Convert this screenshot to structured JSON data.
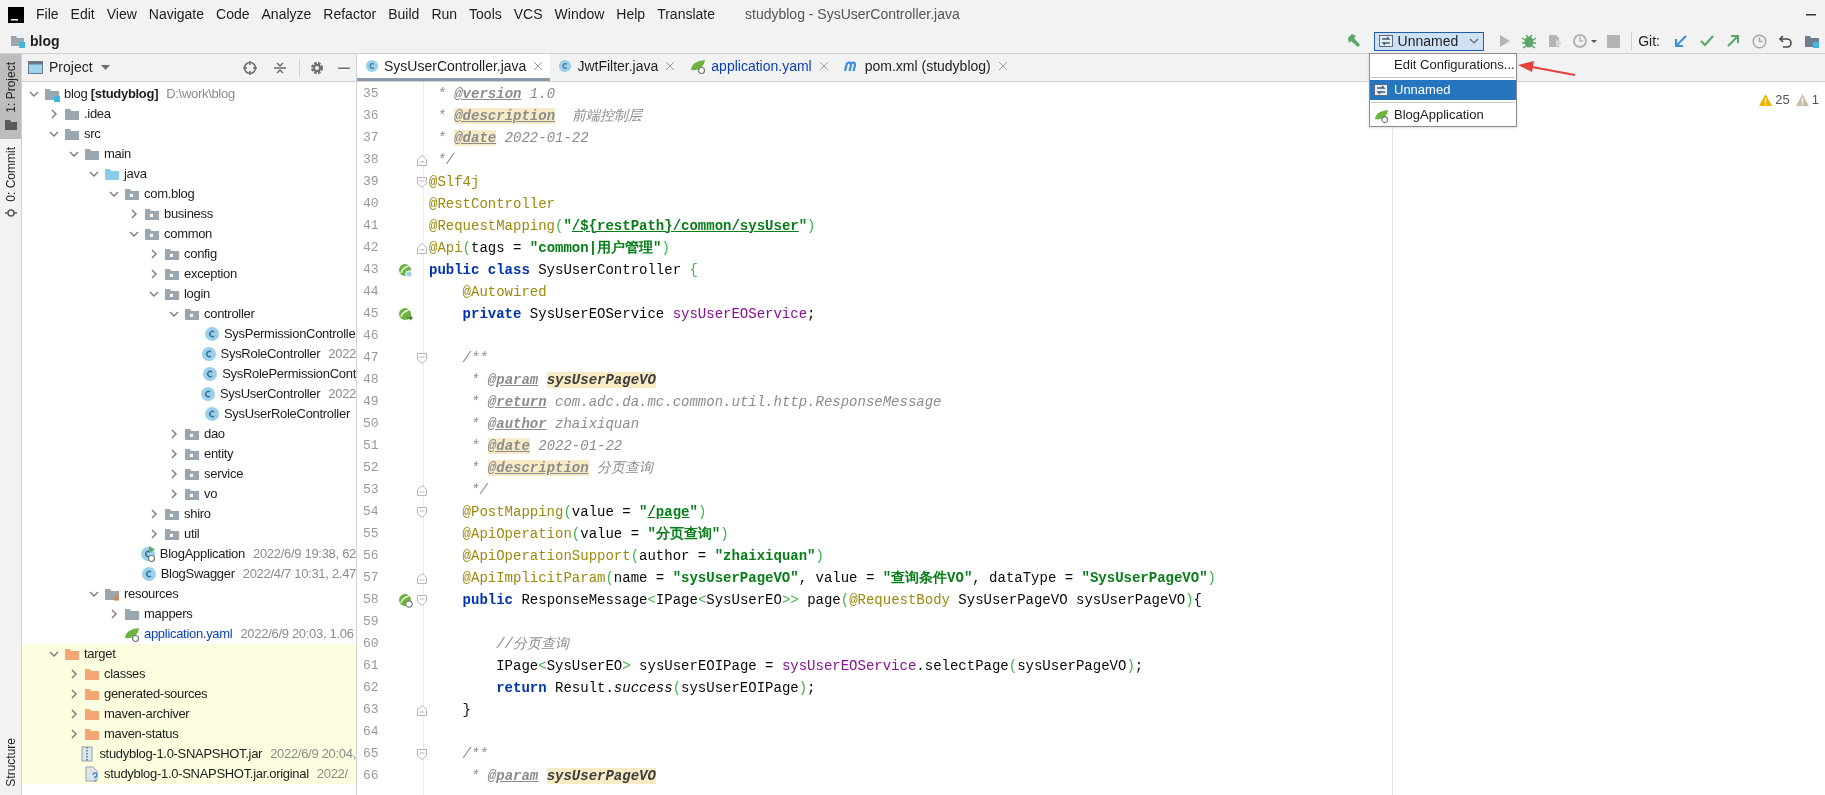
{
  "window": {
    "title": "studyblog - SysUserController.java"
  },
  "menu": [
    "File",
    "Edit",
    "View",
    "Navigate",
    "Code",
    "Analyze",
    "Refactor",
    "Build",
    "Run",
    "Tools",
    "VCS",
    "Window",
    "Help",
    "Translate"
  ],
  "breadcrumb": "blog",
  "toolbar": [
    {
      "kind": "build",
      "disabled": false
    },
    {
      "kind": "run",
      "disabled": true
    },
    {
      "kind": "debug",
      "disabled": false
    },
    {
      "kind": "coverage",
      "disabled": true
    },
    {
      "kind": "profile",
      "disabled": true
    },
    {
      "kind": "stop",
      "disabled": true
    }
  ],
  "run_config": {
    "label": "Unnamed",
    "expanded": true
  },
  "git": {
    "label": "Git:",
    "actions": [
      {
        "kind": "update"
      },
      {
        "kind": "commit"
      },
      {
        "kind": "push"
      },
      {
        "kind": "history"
      },
      {
        "kind": "rollback"
      },
      {
        "kind": "project"
      }
    ]
  },
  "run_config_menu": [
    {
      "label": "Edit Configurations...",
      "kind": "action",
      "selected": false
    },
    {
      "label": "Unnamed",
      "kind": "config",
      "selected": true
    },
    {
      "label": "BlogApplication",
      "kind": "app",
      "selected": false
    }
  ],
  "left_stripe": [
    {
      "label": "1: Project",
      "kind": "project",
      "selected": true
    },
    {
      "label": "0: Commit",
      "kind": "commit",
      "selected": false
    },
    {
      "label": "Structure",
      "kind": "structure",
      "selected": false
    }
  ],
  "project_panel": {
    "title": "Project"
  },
  "project_tree": [
    {
      "name": "blog **[studyblog]**",
      "detail": "D:\\work\\blog",
      "kind": "module",
      "expanded": true,
      "children": [
        {
          "name": ".idea",
          "kind": "folder",
          "expanded": false
        },
        {
          "name": "src",
          "kind": "folder",
          "expanded": true,
          "children": [
            {
              "name": "main",
              "kind": "folder",
              "expanded": true,
              "children": [
                {
                  "name": "java",
                  "kind": "source-root",
                  "expanded": true,
                  "children": [
                    {
                      "name": "com.blog",
                      "kind": "package",
                      "expanded": true,
                      "children": [
                        {
                          "name": "business",
                          "kind": "package",
                          "expanded": false
                        },
                        {
                          "name": "common",
                          "kind": "package",
                          "expanded": true,
                          "children": [
                            {
                              "name": "config",
                              "kind": "package",
                              "expanded": false
                            },
                            {
                              "name": "exception",
                              "kind": "package",
                              "expanded": false
                            },
                            {
                              "name": "login",
                              "kind": "package",
                              "expanded": true,
                              "children": [
                                {
                                  "name": "controller",
                                  "kind": "package",
                                  "expanded": true,
                                  "children": [
                                    {
                                      "name": "SysPermissionControlle",
                                      "kind": "class",
                                      "modified": false
                                    },
                                    {
                                      "name": "SysRoleController",
                                      "kind": "class",
                                      "detail": "2022",
                                      "modified": false
                                    },
                                    {
                                      "name": "SysRolePermissionCont",
                                      "kind": "class",
                                      "modified": false
                                    },
                                    {
                                      "name": "SysUserController",
                                      "kind": "class",
                                      "detail": "2022",
                                      "modified": false
                                    },
                                    {
                                      "name": "SysUserRoleController",
                                      "kind": "class",
                                      "modified": false
                                    }
                                  ]
                                },
                                {
                                  "name": "dao",
                                  "kind": "package",
                                  "expanded": false
                                },
                                {
                                  "name": "entity",
                                  "kind": "package",
                                  "expanded": false
                                },
                                {
                                  "name": "service",
                                  "kind": "package",
                                  "expanded": false
                                },
                                {
                                  "name": "vo",
                                  "kind": "package",
                                  "expanded": false
                                }
                              ]
                            },
                            {
                              "name": "shiro",
                              "kind": "package",
                              "expanded": false
                            },
                            {
                              "name": "util",
                              "kind": "package",
                              "expanded": false
                            }
                          ]
                        },
                        {
                          "name": "BlogApplication",
                          "kind": "app-class",
                          "detail": "2022/6/9 19:38, 62",
                          "modified": false
                        },
                        {
                          "name": "BlogSwagger",
                          "kind": "class",
                          "detail": "2022/4/7 10:31, 2.47",
                          "modified": false
                        }
                      ]
                    }
                  ]
                },
                {
                  "name": "resources",
                  "kind": "resources",
                  "expanded": true,
                  "children": [
                    {
                      "name": "mappers",
                      "kind": "folder",
                      "expanded": false
                    },
                    {
                      "name": "application.yaml",
                      "kind": "yaml",
                      "detail": "2022/6/9 20:03, 1.06",
                      "modified": true
                    }
                  ]
                }
              ]
            }
          ]
        },
        {
          "name": "target",
          "kind": "excluded",
          "expanded": true,
          "children": [
            {
              "name": "classes",
              "kind": "excluded",
              "expanded": false
            },
            {
              "name": "generated-sources",
              "kind": "excluded",
              "expanded": false
            },
            {
              "name": "maven-archiver",
              "kind": "excluded",
              "expanded": false
            },
            {
              "name": "maven-status",
              "kind": "excluded",
              "expanded": false
            },
            {
              "name": "studyblog-1.0-SNAPSHOT.jar",
              "kind": "jar",
              "detail": "2022/6/9 20:04,",
              "modified": false
            },
            {
              "name": "studyblog-1.0-SNAPSHOT.jar.original",
              "kind": "unknown",
              "detail": "2022/",
              "modified": false
            }
          ]
        }
      ]
    }
  ],
  "editor_tabs": [
    {
      "label": "SysUserController.java",
      "kind": "class",
      "selected": true,
      "modified": false
    },
    {
      "label": "JwtFilter.java",
      "kind": "class",
      "selected": false,
      "modified": false
    },
    {
      "label": "application.yaml",
      "kind": "yaml",
      "selected": false,
      "modified": true
    },
    {
      "label": "pom.xml (studyblog)",
      "kind": "maven",
      "selected": false,
      "modified": false
    }
  ],
  "inspections": [
    {
      "count": "25",
      "kind": "warning"
    },
    {
      "count": "1",
      "kind": "weak"
    }
  ],
  "code_lines": [
    {
      "number": "35",
      "segments": [
        {
          "kind": "doc",
          "text": " * "
        },
        {
          "kind": "tag",
          "text": "@version"
        },
        {
          "kind": "doc",
          "text": " 1.0"
        }
      ]
    },
    {
      "number": "36",
      "segments": [
        {
          "kind": "doc",
          "text": " * "
        },
        {
          "kind": "taghl",
          "text": "@description"
        },
        {
          "kind": "doc",
          "text": "  前端控制层"
        }
      ]
    },
    {
      "number": "37",
      "segments": [
        {
          "kind": "doc",
          "text": " * "
        },
        {
          "kind": "taghl",
          "text": "@date"
        },
        {
          "kind": "doc",
          "text": " 2022-01-22"
        }
      ]
    },
    {
      "number": "38",
      "fold": {
        "kind": "close"
      },
      "segments": [
        {
          "kind": "doc",
          "text": " */"
        }
      ]
    },
    {
      "number": "39",
      "fold": {
        "kind": "open"
      },
      "segments": [
        {
          "kind": "ann",
          "text": "@Slf4j"
        }
      ]
    },
    {
      "number": "40",
      "segments": [
        {
          "kind": "ann",
          "text": "@RestController"
        }
      ]
    },
    {
      "number": "41",
      "segments": [
        {
          "kind": "ann",
          "text": "@RequestMapping"
        },
        {
          "kind": "paren",
          "text": "("
        },
        {
          "kind": "str",
          "text": "\""
        },
        {
          "kind": "link",
          "text": "/${restPath}/common/sysUser"
        },
        {
          "kind": "str",
          "text": "\""
        },
        {
          "kind": "paren",
          "text": ")"
        }
      ]
    },
    {
      "number": "42",
      "fold": {
        "kind": "close"
      },
      "segments": [
        {
          "kind": "ann",
          "text": "@Api"
        },
        {
          "kind": "paren",
          "text": "("
        },
        {
          "kind": "plain",
          "text": "tags = "
        },
        {
          "kind": "str",
          "text": "\"common|用户管理\""
        },
        {
          "kind": "paren",
          "text": ")"
        }
      ]
    },
    {
      "number": "43",
      "marker": {
        "kind": "bean"
      },
      "segments": [
        {
          "kind": "kw",
          "text": "public class "
        },
        {
          "kind": "plain",
          "text": "SysUserController "
        },
        {
          "kind": "paren",
          "text": "{"
        }
      ]
    },
    {
      "number": "44",
      "segments": [
        {
          "kind": "ann",
          "text": "    @Autowired"
        }
      ]
    },
    {
      "number": "45",
      "marker": {
        "kind": "autowired"
      },
      "segments": [
        {
          "kind": "kw",
          "text": "    private "
        },
        {
          "kind": "plain",
          "text": "SysUserEOService "
        },
        {
          "kind": "field",
          "text": "sysUserEOService"
        },
        {
          "kind": "plain",
          "text": ";"
        }
      ]
    },
    {
      "number": "46"
    },
    {
      "number": "47",
      "fold": {
        "kind": "open"
      },
      "segments": [
        {
          "kind": "doc",
          "text": "    /**"
        }
      ]
    },
    {
      "number": "48",
      "segments": [
        {
          "kind": "doc",
          "text": "     * "
        },
        {
          "kind": "tag",
          "text": "@param"
        },
        {
          "kind": "paramhl",
          "text": " sysUserPageVO"
        }
      ]
    },
    {
      "number": "49",
      "segments": [
        {
          "kind": "doc",
          "text": "     * "
        },
        {
          "kind": "tag",
          "text": "@return"
        },
        {
          "kind": "doc",
          "text": " com.adc.da.mc.common.util.http.ResponseMessage"
        }
      ]
    },
    {
      "number": "50",
      "segments": [
        {
          "kind": "doc",
          "text": "     * "
        },
        {
          "kind": "tag",
          "text": "@author"
        },
        {
          "kind": "doc",
          "text": " zhaixiquan"
        }
      ]
    },
    {
      "number": "51",
      "segments": [
        {
          "kind": "doc",
          "text": "     * "
        },
        {
          "kind": "taghl",
          "text": "@date"
        },
        {
          "kind": "doc",
          "text": " 2022-01-22"
        }
      ]
    },
    {
      "number": "52",
      "segments": [
        {
          "kind": "doc",
          "text": "     * "
        },
        {
          "kind": "taghl",
          "text": "@description"
        },
        {
          "kind": "doc",
          "text": " 分页查询"
        }
      ]
    },
    {
      "number": "53",
      "fold": {
        "kind": "close"
      },
      "segments": [
        {
          "kind": "doc",
          "text": "     */"
        }
      ]
    },
    {
      "number": "54",
      "fold": {
        "kind": "open"
      },
      "segments": [
        {
          "kind": "ann",
          "text": "    @PostMapping"
        },
        {
          "kind": "paren",
          "text": "("
        },
        {
          "kind": "plain",
          "text": "value = "
        },
        {
          "kind": "str",
          "text": "\""
        },
        {
          "kind": "link",
          "text": "/page"
        },
        {
          "kind": "str",
          "text": "\""
        },
        {
          "kind": "paren",
          "text": ")"
        }
      ]
    },
    {
      "number": "55",
      "segments": [
        {
          "kind": "ann",
          "text": "    @ApiOperation"
        },
        {
          "kind": "paren",
          "text": "("
        },
        {
          "kind": "plain",
          "text": "value = "
        },
        {
          "kind": "str",
          "text": "\"分页查询\""
        },
        {
          "kind": "paren",
          "text": ")"
        }
      ]
    },
    {
      "number": "56",
      "segments": [
        {
          "kind": "ann",
          "text": "    @ApiOperationSupport"
        },
        {
          "kind": "paren",
          "text": "("
        },
        {
          "kind": "plain",
          "text": "author = "
        },
        {
          "kind": "str",
          "text": "\"zhaixiquan\""
        },
        {
          "kind": "paren",
          "text": ")"
        }
      ]
    },
    {
      "number": "57",
      "fold": {
        "kind": "close"
      },
      "segments": [
        {
          "kind": "ann",
          "text": "    @ApiImplicitParam"
        },
        {
          "kind": "paren",
          "text": "("
        },
        {
          "kind": "plain",
          "text": "name = "
        },
        {
          "kind": "str",
          "text": "\"sysUserPageVO\""
        },
        {
          "kind": "plain",
          "text": ", value = "
        },
        {
          "kind": "str",
          "text": "\"查询条件VO\""
        },
        {
          "kind": "plain",
          "text": ", dataType = "
        },
        {
          "kind": "str",
          "text": "\"SysUserPageVO\""
        },
        {
          "kind": "paren",
          "text": ")"
        }
      ]
    },
    {
      "number": "58",
      "fold": {
        "kind": "open"
      },
      "marker": {
        "kind": "endpoint"
      },
      "segments": [
        {
          "kind": "kw",
          "text": "    public "
        },
        {
          "kind": "plain",
          "text": "ResponseMessage"
        },
        {
          "kind": "paren",
          "text": "<"
        },
        {
          "kind": "plain",
          "text": "IPage"
        },
        {
          "kind": "paren",
          "text": "<"
        },
        {
          "kind": "plain",
          "text": "SysUserEO"
        },
        {
          "kind": "paren",
          "text": ">>"
        },
        {
          "kind": "plain",
          "text": " page"
        },
        {
          "kind": "paren",
          "text": "("
        },
        {
          "kind": "ann",
          "text": "@RequestBody "
        },
        {
          "kind": "plain",
          "text": "SysUserPageVO sysUserPageVO"
        },
        {
          "kind": "paren",
          "text": ")"
        },
        {
          "kind": "plain",
          "text": "{"
        }
      ]
    },
    {
      "number": "59"
    },
    {
      "number": "60",
      "segments": [
        {
          "kind": "comment",
          "text": "        //分页查询"
        }
      ]
    },
    {
      "number": "61",
      "segments": [
        {
          "kind": "plain",
          "text": "        IPage"
        },
        {
          "kind": "paren",
          "text": "<"
        },
        {
          "kind": "plain",
          "text": "SysUserEO"
        },
        {
          "kind": "paren",
          "text": ">"
        },
        {
          "kind": "plain",
          "text": " sysUserEOIPage = "
        },
        {
          "kind": "field",
          "text": "sysUserEOService"
        },
        {
          "kind": "plain",
          "text": ".selectPage"
        },
        {
          "kind": "paren",
          "text": "("
        },
        {
          "kind": "plain",
          "text": "sysUserPageVO"
        },
        {
          "kind": "paren",
          "text": ")"
        },
        {
          "kind": "plain",
          "text": ";"
        }
      ]
    },
    {
      "number": "62",
      "segments": [
        {
          "kind": "kw",
          "text": "        return "
        },
        {
          "kind": "plain",
          "text": "Result."
        },
        {
          "kind": "italic",
          "text": "success"
        },
        {
          "kind": "paren",
          "text": "("
        },
        {
          "kind": "plain",
          "text": "sysUserEOIPage"
        },
        {
          "kind": "paren",
          "text": ")"
        },
        {
          "kind": "plain",
          "text": ";"
        }
      ]
    },
    {
      "number": "63",
      "fold": {
        "kind": "close"
      },
      "segments": [
        {
          "kind": "plain",
          "text": "    }"
        }
      ]
    },
    {
      "number": "64"
    },
    {
      "number": "65",
      "fold": {
        "kind": "open"
      },
      "segments": [
        {
          "kind": "doc",
          "text": "    /**"
        }
      ]
    },
    {
      "number": "66",
      "segments": [
        {
          "kind": "doc",
          "text": "     * "
        },
        {
          "kind": "tag",
          "text": "@param"
        },
        {
          "kind": "paramhl",
          "text": " sysUserPageVO"
        }
      ]
    }
  ]
}
